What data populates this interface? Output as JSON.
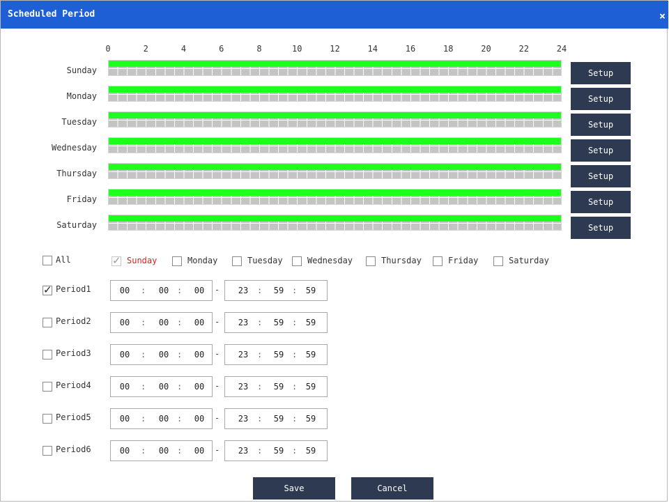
{
  "dialog": {
    "title": "Scheduled Period",
    "close_label": "×"
  },
  "timeline": {
    "hour_labels": [
      "0",
      "2",
      "4",
      "6",
      "8",
      "10",
      "12",
      "14",
      "16",
      "18",
      "20",
      "22",
      "24"
    ],
    "days": [
      {
        "label": "Sunday",
        "setup_label": "Setup",
        "scheduled": [
          "00:00:00",
          "23:59:59"
        ]
      },
      {
        "label": "Monday",
        "setup_label": "Setup",
        "scheduled": [
          "00:00:00",
          "23:59:59"
        ]
      },
      {
        "label": "Tuesday",
        "setup_label": "Setup",
        "scheduled": [
          "00:00:00",
          "23:59:59"
        ]
      },
      {
        "label": "Wednesday",
        "setup_label": "Setup",
        "scheduled": [
          "00:00:00",
          "23:59:59"
        ]
      },
      {
        "label": "Thursday",
        "setup_label": "Setup",
        "scheduled": [
          "00:00:00",
          "23:59:59"
        ]
      },
      {
        "label": "Friday",
        "setup_label": "Setup",
        "scheduled": [
          "00:00:00",
          "23:59:59"
        ]
      },
      {
        "label": "Saturday",
        "setup_label": "Setup",
        "scheduled": [
          "00:00:00",
          "23:59:59"
        ]
      }
    ],
    "colors": {
      "scheduled": "#1dff1d",
      "grid": "#c4c4c4"
    }
  },
  "day_select": {
    "all": {
      "label": "All",
      "checked": false
    },
    "days": [
      {
        "label": "Sunday",
        "checked": true,
        "disabled": true,
        "highlight": true
      },
      {
        "label": "Monday",
        "checked": false
      },
      {
        "label": "Tuesday",
        "checked": false
      },
      {
        "label": "Wednesday",
        "checked": false
      },
      {
        "label": "Thursday",
        "checked": false
      },
      {
        "label": "Friday",
        "checked": false
      },
      {
        "label": "Saturday",
        "checked": false
      }
    ]
  },
  "periods": [
    {
      "label": "Period1",
      "checked": true,
      "start": [
        "00",
        "00",
        "00"
      ],
      "end": [
        "23",
        "59",
        "59"
      ]
    },
    {
      "label": "Period2",
      "checked": false,
      "start": [
        "00",
        "00",
        "00"
      ],
      "end": [
        "23",
        "59",
        "59"
      ]
    },
    {
      "label": "Period3",
      "checked": false,
      "start": [
        "00",
        "00",
        "00"
      ],
      "end": [
        "23",
        "59",
        "59"
      ]
    },
    {
      "label": "Period4",
      "checked": false,
      "start": [
        "00",
        "00",
        "00"
      ],
      "end": [
        "23",
        "59",
        "59"
      ]
    },
    {
      "label": "Period5",
      "checked": false,
      "start": [
        "00",
        "00",
        "00"
      ],
      "end": [
        "23",
        "59",
        "59"
      ]
    },
    {
      "label": "Period6",
      "checked": false,
      "start": [
        "00",
        "00",
        "00"
      ],
      "end": [
        "23",
        "59",
        "59"
      ]
    }
  ],
  "time_separator": ":",
  "range_separator": "-",
  "footer": {
    "save_label": "Save",
    "cancel_label": "Cancel"
  },
  "colors": {
    "title_bar": "#1f5fd6",
    "button": "#2d3a52",
    "highlight_text": "#e02020"
  }
}
